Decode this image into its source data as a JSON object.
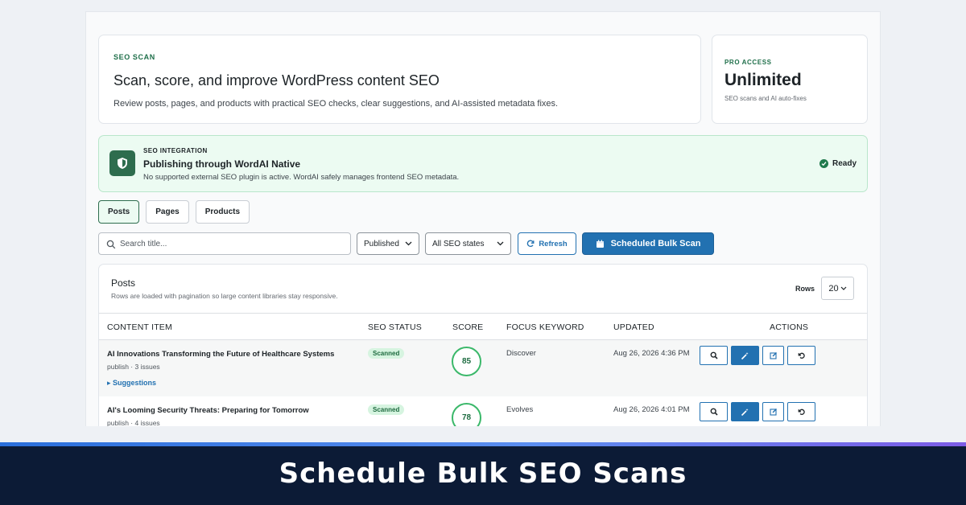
{
  "hero": {
    "eyebrow": "SEO SCAN",
    "title": "Scan, score, and improve WordPress content SEO",
    "description": "Review posts, pages, and products with practical SEO checks, clear suggestions, and AI-assisted metadata fixes."
  },
  "pro": {
    "eyebrow": "PRO ACCESS",
    "value": "Unlimited",
    "note": "SEO scans and AI auto-fixes"
  },
  "integration": {
    "eyebrow": "SEO INTEGRATION",
    "title": "Publishing through WordAI Native",
    "description": "No supported external SEO plugin is active. WordAI safely manages frontend SEO metadata.",
    "status": "Ready",
    "status_color": "#1f7a4c"
  },
  "tabs": [
    {
      "label": "Posts",
      "active": true
    },
    {
      "label": "Pages",
      "active": false
    },
    {
      "label": "Products",
      "active": false
    }
  ],
  "filters": {
    "search_placeholder": "Search title...",
    "status_select": "Published",
    "seo_state_select": "All SEO states",
    "refresh_label": "Refresh",
    "bulk_scan_label": "Scheduled Bulk Scan"
  },
  "table": {
    "title": "Posts",
    "subtitle": "Rows are loaded with pagination so large content libraries stay responsive.",
    "rows_label": "Rows",
    "rows_value": "20",
    "columns": [
      "CONTENT ITEM",
      "SEO STATUS",
      "SCORE",
      "FOCUS KEYWORD",
      "UPDATED",
      "ACTIONS"
    ],
    "rows": [
      {
        "title": "AI Innovations Transforming the Future of Healthcare Systems",
        "meta": "publish · 3 issues",
        "suggestions": "▸ Suggestions",
        "status": "Scanned",
        "score": "85",
        "keyword": "Discover",
        "updated": "Aug 26, 2026 4:36 PM"
      },
      {
        "title": "AI's Looming Security Threats: Preparing for Tomorrow",
        "meta": "publish · 4 issues",
        "status": "Scanned",
        "score": "78",
        "keyword": "Evolves",
        "updated": "Aug 26, 2026 4:01 PM"
      }
    ]
  },
  "caption": "Schedule Bulk SEO Scans",
  "colors": {
    "accent": "#2271b1",
    "brand_green": "#2e6d4e",
    "footer_bg": "#0c1b36"
  }
}
